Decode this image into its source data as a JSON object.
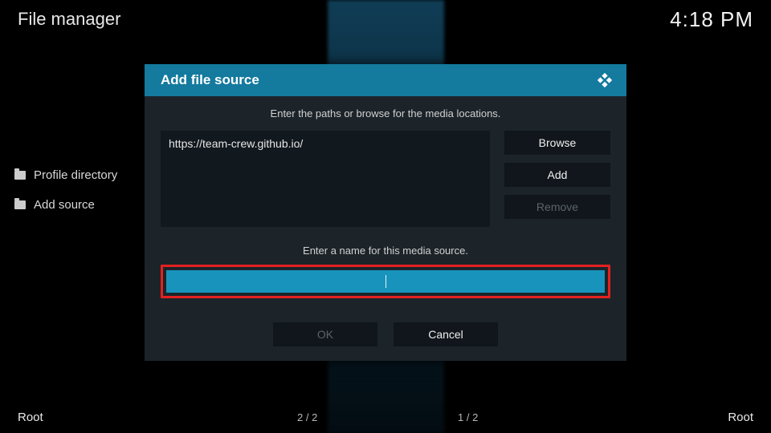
{
  "header": {
    "title": "File manager",
    "clock": "4:18 PM"
  },
  "sidebar": {
    "items": [
      {
        "label": "Profile directory"
      },
      {
        "label": "Add source"
      }
    ]
  },
  "dialog": {
    "title": "Add file source",
    "hint_paths": "Enter the paths or browse for the media locations.",
    "path_value": "https://team-crew.github.io/",
    "browse_label": "Browse",
    "add_label": "Add",
    "remove_label": "Remove",
    "hint_name": "Enter a name for this media source.",
    "name_value": "",
    "ok_label": "OK",
    "cancel_label": "Cancel"
  },
  "footer": {
    "left_root": "Root",
    "right_root": "Root",
    "pager_left": "2 / 2",
    "pager_right": "1 / 2"
  }
}
